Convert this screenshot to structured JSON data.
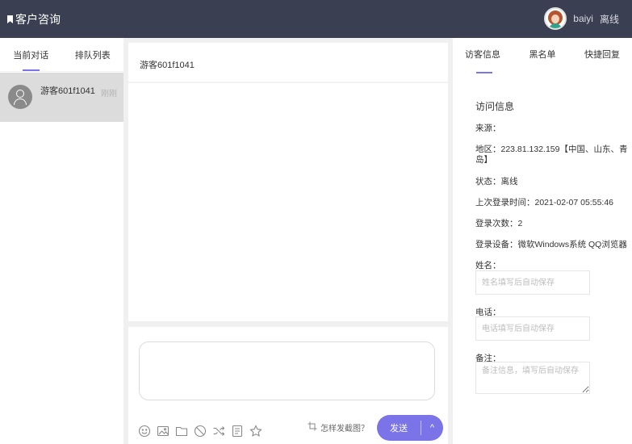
{
  "header": {
    "title": "客户咨询",
    "user_name": "baiyi",
    "user_status": "离线"
  },
  "left_panel": {
    "tabs": [
      {
        "label": "当前对话",
        "active": true
      },
      {
        "label": "排队列表",
        "active": false
      }
    ],
    "sessions": [
      {
        "name": "游客601f1041",
        "time": "刚刚"
      }
    ]
  },
  "chat": {
    "title": "游客601f1041",
    "toolbar_icons": [
      "emoji-icon",
      "image-icon",
      "folder-icon",
      "block-icon",
      "transfer-icon",
      "history-icon",
      "star-icon"
    ],
    "screenshot_help": "怎样发截图？",
    "send_label": "发送",
    "send_caret": "^"
  },
  "right_panel": {
    "tabs": [
      {
        "label": "访客信息",
        "active": true
      },
      {
        "label": "黑名单",
        "active": false
      },
      {
        "label": "快捷回复",
        "active": false
      }
    ],
    "section_title": "访问信息",
    "source": "来源：",
    "region_line1": "地区：223.81.132.159【中国、山东、青",
    "region_line2": "岛】",
    "status": "状态：离线",
    "last_login": "上次登录时间：2021-02-07 05:55:46",
    "login_count": "登录次数：2",
    "device": "登录设备：微软Windows系统 QQ浏览器",
    "name_label": "姓名：",
    "name_placeholder": "姓名填写后自动保存",
    "phone_label": "电话：",
    "phone_placeholder": "电话填写后自动保存",
    "note_label": "备注：",
    "note_placeholder": "备注信息，填写后自动保存"
  },
  "colors": {
    "topbar": "#3a3f51",
    "accent": "#7b73e8",
    "selected_session": "#dcdcdc"
  }
}
